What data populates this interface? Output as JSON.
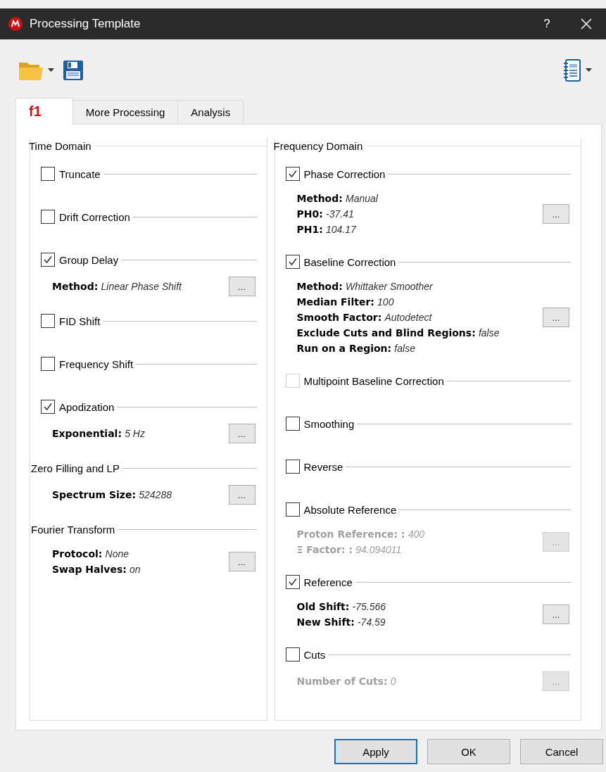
{
  "window": {
    "title": "Processing Template",
    "help": "?"
  },
  "tabs": [
    {
      "label": "f1",
      "kind": "logo",
      "selected": true
    },
    {
      "label": "More Processing",
      "kind": "text",
      "selected": false
    },
    {
      "label": "Analysis",
      "kind": "text",
      "selected": false
    }
  ],
  "columns": [
    {
      "title": "Time Domain",
      "items": [
        {
          "kind": "check",
          "label": "Truncate",
          "checked": false,
          "disabled": false
        },
        {
          "kind": "check",
          "label": "Drift Correction",
          "checked": false,
          "disabled": false
        },
        {
          "kind": "check",
          "label": "Group Delay",
          "checked": true,
          "disabled": false,
          "details": {
            "disabled": false,
            "button": "...",
            "lines": [
              {
                "label": "Method:",
                "value": "Linear Phase Shift"
              }
            ]
          }
        },
        {
          "kind": "check",
          "label": "FID Shift",
          "checked": false,
          "disabled": false
        },
        {
          "kind": "check",
          "label": "Frequency Shift",
          "checked": false,
          "disabled": false
        },
        {
          "kind": "check",
          "label": "Apodization",
          "checked": true,
          "disabled": false,
          "details": {
            "disabled": false,
            "button": "...",
            "lines": [
              {
                "label": "Exponential:",
                "value": "5 Hz"
              }
            ]
          }
        },
        {
          "kind": "heading",
          "label": "Zero Filling and LP",
          "details": {
            "disabled": false,
            "button": "...",
            "lines": [
              {
                "label": "Spectrum Size:",
                "value": "524288"
              }
            ]
          }
        },
        {
          "kind": "heading",
          "label": "Fourier Transform",
          "details": {
            "disabled": false,
            "button": "...",
            "lines": [
              {
                "label": "Protocol:",
                "value": "None"
              },
              {
                "label": "Swap Halves:",
                "value": "on"
              }
            ]
          }
        }
      ]
    },
    {
      "title": "Frequency Domain",
      "items": [
        {
          "kind": "check",
          "label": "Phase Correction",
          "checked": true,
          "disabled": false,
          "details": {
            "disabled": false,
            "button": "...",
            "lines": [
              {
                "label": "Method:",
                "value": "Manual"
              },
              {
                "label": "PH0:",
                "value": "-37.41"
              },
              {
                "label": "PH1:",
                "value": "104.17"
              }
            ]
          }
        },
        {
          "kind": "check",
          "label": "Baseline Correction",
          "checked": true,
          "disabled": false,
          "details": {
            "disabled": false,
            "button": "...",
            "lines": [
              {
                "label": "Method:",
                "value": "Whittaker Smoother"
              },
              {
                "label": "Median Filter:",
                "value": "100"
              },
              {
                "label": "Smooth Factor:",
                "value": "Autodetect"
              },
              {
                "label": "Exclude Cuts and Blind Regions:",
                "value": "false"
              },
              {
                "label": "Run on a Region:",
                "value": "false"
              }
            ]
          }
        },
        {
          "kind": "check",
          "label": "Multipoint Baseline Correction",
          "checked": false,
          "disabled": true
        },
        {
          "kind": "check",
          "label": "Smoothing",
          "checked": false,
          "disabled": false
        },
        {
          "kind": "check",
          "label": "Reverse",
          "checked": false,
          "disabled": false
        },
        {
          "kind": "check",
          "label": "Absolute Reference",
          "checked": false,
          "disabled": false,
          "details": {
            "disabled": true,
            "button": "...",
            "lines": [
              {
                "label": "Proton Reference: :",
                "value": "400"
              },
              {
                "label": "Ξ Factor: :",
                "value": "94.094011"
              }
            ]
          }
        },
        {
          "kind": "check",
          "label": "Reference",
          "checked": true,
          "disabled": false,
          "details": {
            "disabled": false,
            "button": "...",
            "lines": [
              {
                "label": "Old Shift:",
                "value": "-75.566"
              },
              {
                "label": "New Shift:",
                "value": "-74.59"
              }
            ]
          }
        },
        {
          "kind": "check",
          "label": "Cuts",
          "checked": false,
          "disabled": false,
          "details": {
            "disabled": true,
            "button": "...",
            "lines": [
              {
                "label": "Number of Cuts:",
                "value": "0"
              }
            ]
          }
        }
      ]
    }
  ],
  "buttons": [
    {
      "label": "Apply",
      "focused": true
    },
    {
      "label": "OK",
      "focused": false
    },
    {
      "label": "Cancel",
      "focused": false
    }
  ]
}
